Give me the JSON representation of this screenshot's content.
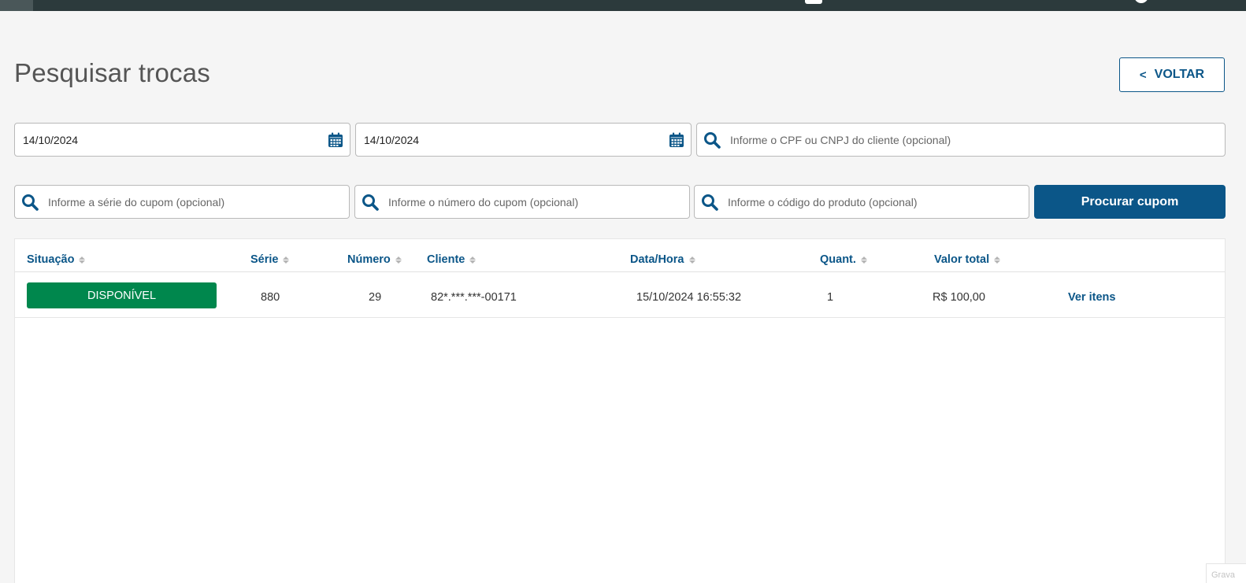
{
  "page": {
    "title": "Pesquisar trocas",
    "back_label": "VOLTAR",
    "back_icon": "<"
  },
  "filters": {
    "date_start": {
      "value": "14/10/2024",
      "icon": "calendar-icon"
    },
    "date_end": {
      "value": "14/10/2024",
      "icon": "calendar-icon"
    },
    "document": {
      "value": "",
      "placeholder": "Informe o CPF ou CNPJ do cliente (opcional)",
      "icon": "search-icon"
    },
    "serie": {
      "value": "",
      "placeholder": "Informe a série do cupom (opcional)",
      "icon": "search-icon"
    },
    "numero": {
      "value": "",
      "placeholder": "Informe o número do cupom (opcional)",
      "icon": "search-icon"
    },
    "produto": {
      "value": "",
      "placeholder": "Informe o código do produto (opcional)",
      "icon": "search-icon"
    },
    "submit_label": "Procurar cupom"
  },
  "table": {
    "columns": [
      "Situação",
      "Série",
      "Número",
      "Cliente",
      "Data/Hora",
      "Quant.",
      "Valor total"
    ],
    "rows": [
      {
        "situacao": "DISPONÍVEL",
        "serie": "880",
        "numero": "29",
        "cliente": "82*.***.***-00171",
        "data_hora": "15/10/2024 16:55:32",
        "quant": "1",
        "valor_total": "R$ 100,00",
        "action": "Ver itens"
      }
    ]
  },
  "watermark": "Grava",
  "colors": {
    "primary": "#0b5688",
    "status_available": "#00874d",
    "topbar": "#2c3a3c",
    "background": "#f5f5f5"
  }
}
